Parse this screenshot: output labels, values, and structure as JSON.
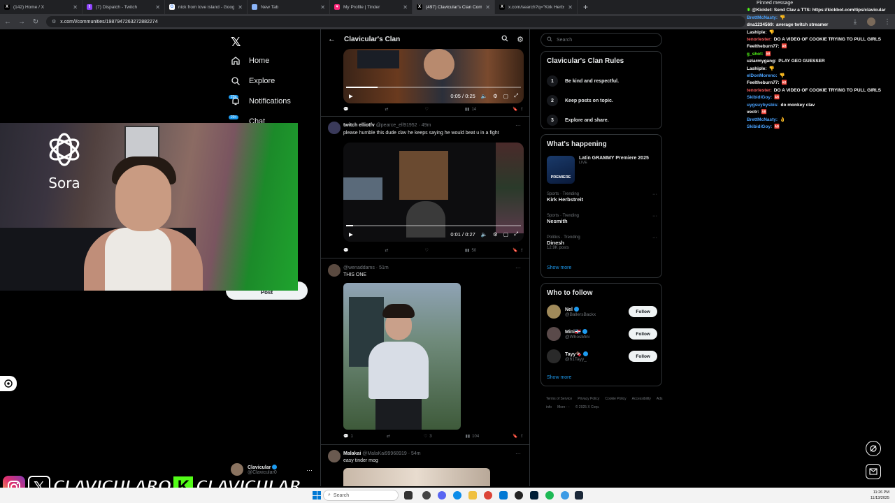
{
  "browser": {
    "tabs": [
      {
        "title": "(142) Home / X",
        "fav": "X",
        "color": "#000000",
        "active": false
      },
      {
        "title": "(7) Dispatch - Twitch",
        "fav": "t",
        "color": "#9146ff",
        "active": false
      },
      {
        "title": "nick from love island - Google ...",
        "fav": "G",
        "color": "#ffffff",
        "active": false
      },
      {
        "title": "New Tab",
        "fav": "",
        "color": "#8ab4f8",
        "active": false
      },
      {
        "title": "My Profile | Tinder",
        "fav": "♥",
        "color": "#fd267a",
        "active": false
      },
      {
        "title": "(497) Clavicular's Clan Commu...",
        "fav": "X",
        "color": "#000000",
        "active": true
      },
      {
        "title": "x.com/search?q=\"Kirk Herbstr...",
        "fav": "X",
        "color": "#000000",
        "active": false
      }
    ],
    "url": "x.com/i/communities/1987947263272882274"
  },
  "nav": {
    "home": "Home",
    "explore": "Explore",
    "notifications": "Notifications",
    "notif_badge": "20+",
    "chat": "Chat",
    "chat_badge": "20+",
    "post": "Post",
    "profile_name": "Clavicular",
    "profile_handle": "@Clavicular0"
  },
  "webcam": {
    "logo_text": "Sora"
  },
  "feed": {
    "title": "Clavicular's Clan",
    "tweet1": {
      "time": "0:05 / 0:25",
      "views": "14",
      "progress": 0.18
    },
    "tweet2": {
      "author": "twitch elliotfv",
      "handle": "@pearce_ell91952 · 49m",
      "text": "please humble this dude clav he keeps saying he would beat u in a fight",
      "time": "0:01 / 0:27",
      "views": "50",
      "progress": 0.04
    },
    "tweet3": {
      "handle": "@wenaddams · 51m",
      "text": "THIS ONE",
      "replies": "1",
      "likes": "3",
      "views": "104"
    },
    "tweet4": {
      "author": "Malakai",
      "handle": "@MalaKai99968919 · 54m",
      "text": "easy tinder mog"
    }
  },
  "right": {
    "search_placeholder": "Search",
    "rules_title": "Clavicular's Clan Rules",
    "rules": [
      {
        "num": "1",
        "text": "Be kind and respectful."
      },
      {
        "num": "2",
        "text": "Keep posts on topic."
      },
      {
        "num": "3",
        "text": "Explore and share."
      }
    ],
    "happening_title": "What's happening",
    "featured": {
      "name": "Latin GRAMMY Premiere 2025",
      "status": "LIVE",
      "thumb_text": "PREMIERE"
    },
    "trends": [
      {
        "category": "Sports · Trending",
        "name": "Kirk Herbstreit",
        "count": ""
      },
      {
        "category": "Sports · Trending",
        "name": "Nesmith",
        "count": ""
      },
      {
        "category": "Politics · Trending",
        "name": "Dinesh",
        "count": "12.9K posts"
      }
    ],
    "show_more": "Show more",
    "wtf_title": "Who to follow",
    "follow_label": "Follow",
    "who_to_follow": [
      {
        "name": "Nel",
        "handle": "@BallersBackx",
        "color": "#a08a5a"
      },
      {
        "name": "Mini🇩🇴",
        "handle": "@WhosMini",
        "color": "#5a4a4a"
      },
      {
        "name": "Tayy🍫",
        "handle": "@61Tayy_",
        "color": "#2a2a2a"
      }
    ],
    "footer": [
      "Terms of Service",
      "Privacy Policy",
      "Cookie Policy",
      "Accessibility",
      "Ads info",
      "More ···",
      "© 2025 X Corp."
    ]
  },
  "chat": {
    "pinned_title": "Pinned message",
    "pinned_text": "@Kicklet: Send Clav a TTS: https://kickbot.com/tips/clavicular",
    "messages": [
      {
        "user": "BrettMcNasty:",
        "color": "#4aa3ff",
        "text": "👎"
      },
      {
        "user": "dna1234569:",
        "color": "#ffffff",
        "text": "average twitch streamer"
      },
      {
        "user": "Lashiple:",
        "color": "#ffffff",
        "text": "👎"
      },
      {
        "user": "tenorlester:",
        "color": "#ff5c5c",
        "text": "DO A VIDEO OF COOKIE TRYING TO PULL GIRLS"
      },
      {
        "user": "Feeltheburn77:",
        "color": "#ffffff",
        "text": "🆎"
      },
      {
        "user": "g_shot:",
        "color": "#53fc18",
        "text": "🆎"
      },
      {
        "user": "uziarmygang:",
        "color": "#ffffff",
        "text": "PLAY GEO GUESSER"
      },
      {
        "user": "Lashiple:",
        "color": "#ffffff",
        "text": "👎"
      },
      {
        "user": "elDonMoreno:",
        "color": "#4aa3ff",
        "text": "👎"
      },
      {
        "user": "Feeltheburn77:",
        "color": "#ffffff",
        "text": "🆎"
      },
      {
        "user": "tenorlester:",
        "color": "#ff5c5c",
        "text": "DO A VIDEO OF COOKIE TRYING TO PULL GIRLS"
      },
      {
        "user": "SkibidiGoy:",
        "color": "#4aa3ff",
        "text": "🆎"
      },
      {
        "user": "uygsuybysbis:",
        "color": "#4aa3ff",
        "text": "do monkey clav"
      },
      {
        "user": "vectr:",
        "color": "#ffffff",
        "text": "🆎"
      },
      {
        "user": "BrettMcNasty:",
        "color": "#4aa3ff",
        "text": "👌"
      },
      {
        "user": "SkibidiGoy:",
        "color": "#4aa3ff",
        "text": "🆎"
      }
    ]
  },
  "banner": {
    "text1": "CLAVICULARO",
    "kick": "K",
    "text2": "CLAVICULAR"
  },
  "taskbar": {
    "search": "Search",
    "time": "11:26 PM",
    "date": "11/13/2025"
  }
}
